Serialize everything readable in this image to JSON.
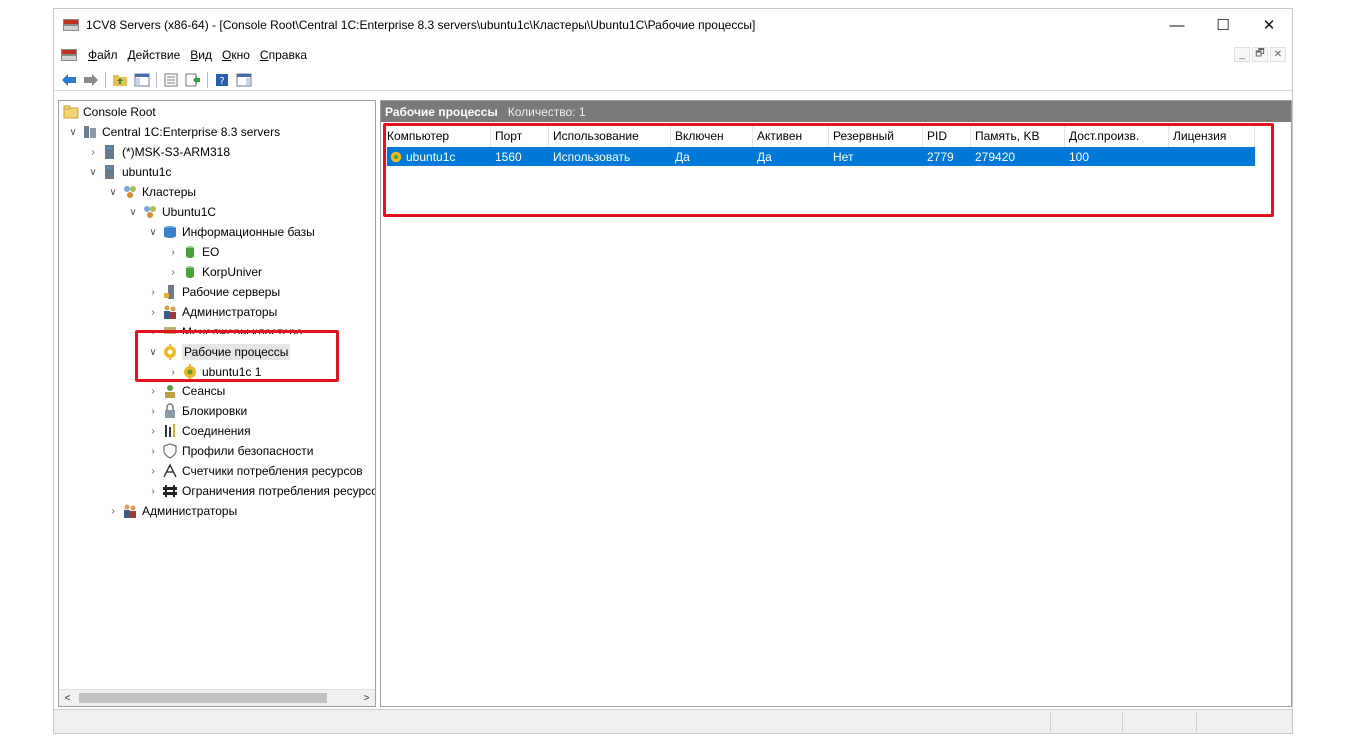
{
  "window": {
    "title": "1CV8 Servers (x86-64) - [Console Root\\Central 1C:Enterprise 8.3 servers\\ubuntu1c\\Кластеры\\Ubuntu1C\\Рабочие процессы]",
    "controls": {
      "minimize": "—",
      "maximize": "☐",
      "close": "✕"
    }
  },
  "menu": {
    "items": [
      {
        "ul": "Ф",
        "rest": "айл"
      },
      {
        "ul": "Д",
        "rest": "ействие"
      },
      {
        "ul": "В",
        "rest": "ид"
      },
      {
        "ul": "О",
        "rest": "кно"
      },
      {
        "ul": "С",
        "rest": "правка"
      }
    ],
    "mdi": {
      "minimize": "_",
      "restore": "🗗",
      "close": "✕"
    }
  },
  "tree": {
    "items": [
      {
        "label": "Console Root",
        "chevron": ""
      },
      {
        "label": "Central 1C:Enterprise 8.3 servers",
        "chevron": "∨"
      },
      {
        "label": "(*)MSK-S3-ARM318",
        "chevron": "›"
      },
      {
        "label": "ubuntu1c",
        "chevron": "∨"
      },
      {
        "label": "Кластеры",
        "chevron": "∨"
      },
      {
        "label": "Ubuntu1C",
        "chevron": "∨"
      },
      {
        "label": "Информационные базы",
        "chevron": "∨"
      },
      {
        "label": "EO",
        "chevron": "›"
      },
      {
        "label": "KorpUniver",
        "chevron": "›"
      },
      {
        "label": "Рабочие серверы",
        "chevron": "›"
      },
      {
        "label": "Администраторы",
        "chevron": "›"
      },
      {
        "label": "Менеджеры кластера",
        "chevron": "›"
      },
      {
        "label": "Рабочие процессы",
        "chevron": "∨"
      },
      {
        "label": "ubuntu1c 1",
        "chevron": "›"
      },
      {
        "label": "Сеансы",
        "chevron": "›"
      },
      {
        "label": "Блокировки",
        "chevron": "›"
      },
      {
        "label": "Соединения",
        "chevron": "›"
      },
      {
        "label": "Профили безопасности",
        "chevron": "›"
      },
      {
        "label": "Счетчики потребления ресурсов",
        "chevron": "›"
      },
      {
        "label": "Ограничения потребления ресурсов",
        "chevron": "›"
      },
      {
        "label": "Администраторы",
        "chevron": "›"
      }
    ],
    "scroll_left": "<",
    "scroll_right": ">"
  },
  "list": {
    "title": "Рабочие процессы",
    "count": "Количество: 1",
    "columns": [
      "Компьютер",
      "Порт",
      "Использование",
      "Включен",
      "Активен",
      "Резервный",
      "PID",
      "Память, KB",
      "Дост.произв.",
      "Лицензия"
    ],
    "rows": [
      [
        "ubuntu1c",
        "1560",
        "Использовать",
        "Да",
        "Да",
        "Нет",
        "2779",
        "279420",
        "100",
        ""
      ]
    ]
  },
  "colors": {
    "selection": "#0078d7",
    "highlight": "#e0141e",
    "header_bar": "#7a7a7a"
  }
}
